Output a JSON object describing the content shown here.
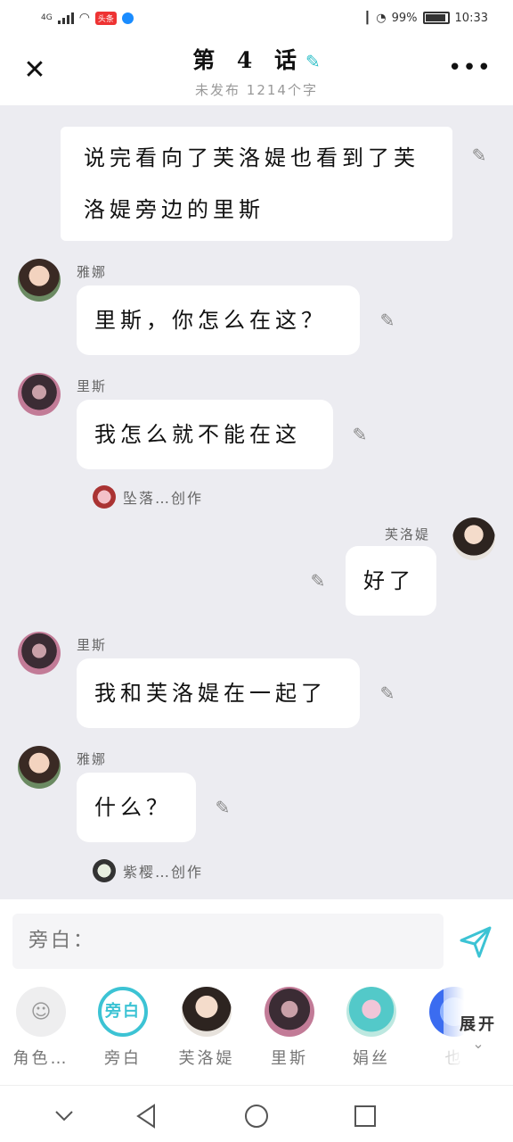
{
  "status": {
    "network": "4G",
    "news_badge": "头条",
    "battery": "99%",
    "time": "10:33"
  },
  "header": {
    "title": "第 4 话",
    "subtitle": "未发布 1214个字"
  },
  "chat": {
    "narration": "说完看向了芙洛媞也看到了芙洛媞旁边的里斯",
    "messages": [
      {
        "name": "雅娜",
        "text": "里斯，你怎么在这？"
      },
      {
        "name": "里斯",
        "text": "我怎么就不能在这"
      },
      {
        "name": "芙洛媞",
        "text": "好了"
      },
      {
        "name": "里斯",
        "text": "我和芙洛媞在一起了"
      },
      {
        "name": "雅娜",
        "text": "什么？"
      }
    ],
    "creators": [
      "坠落…创作",
      "紫樱…创作"
    ]
  },
  "input": {
    "placeholder": "旁白："
  },
  "characters": [
    {
      "label": "角色…",
      "icon": "person-icon"
    },
    {
      "label": "旁白",
      "icon_text": "旁白"
    },
    {
      "label": "芙洛媞"
    },
    {
      "label": "里斯"
    },
    {
      "label": "娟丝"
    },
    {
      "label": "也"
    }
  ],
  "expand_label": "展开",
  "colors": {
    "accent": "#3cc3d4",
    "background": "#ececf1"
  }
}
